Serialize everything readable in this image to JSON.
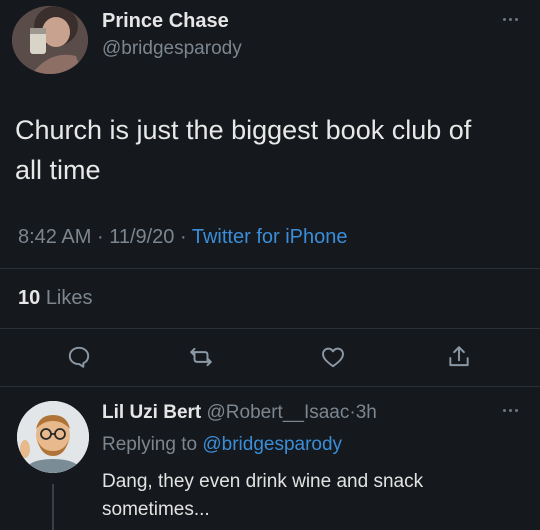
{
  "tweet": {
    "author_name": "Prince Chase",
    "author_handle": "@bridgesparody",
    "text_line1": "Church is just the biggest book club of",
    "text_line2": "all time",
    "time": "8:42 AM",
    "date": "11/9/20",
    "source": "Twitter for iPhone",
    "likes_count": "10",
    "likes_label": "Likes",
    "sep": "·"
  },
  "reply": {
    "author_name": "Lil Uzi Bert",
    "author_handle": "@Robert__Isaac",
    "sep": "·",
    "age": "3h",
    "replying_prefix": "Replying to",
    "replying_to": "@bridgesparody",
    "text_line1": "Dang, they even drink wine and snack",
    "text_line2": "sometimes..."
  },
  "icons": {
    "reply": "reply-icon",
    "retweet": "retweet-icon",
    "like": "heart-icon",
    "share": "share-icon",
    "more": "more-icon"
  },
  "colors": {
    "background": "#15181c",
    "link": "#3a8ed8",
    "muted": "#7c8690",
    "text": "#d9d9d9"
  }
}
